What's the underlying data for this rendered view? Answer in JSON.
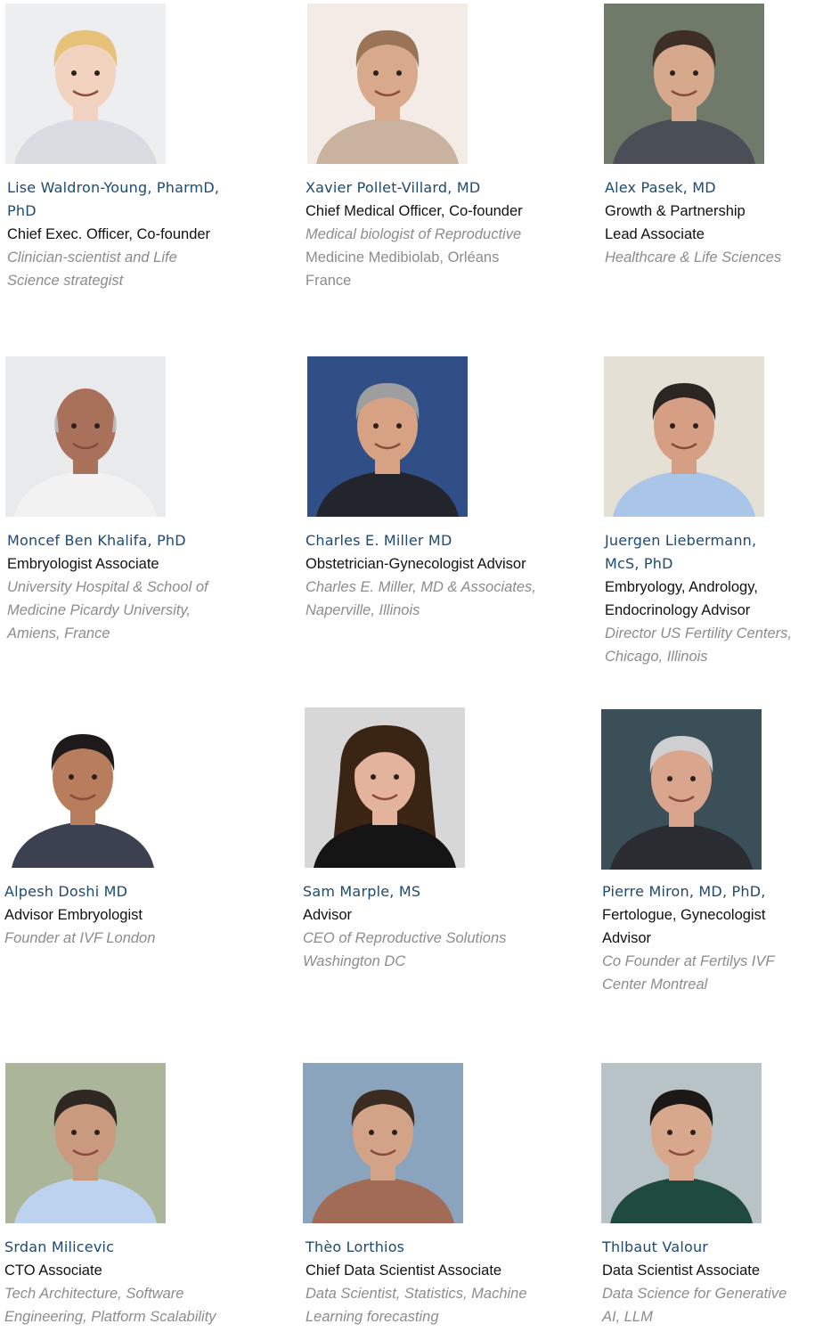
{
  "team": [
    {
      "name": [
        "Lise Waldron-Young, PharmD,",
        "PhD"
      ],
      "role": [
        "Chief Exec. Officer, Co-founder"
      ],
      "desc": [
        "Clinician-scientist and Life",
        "Science strategist"
      ],
      "desc_italic": true,
      "photo": {
        "bg": "#eceef0",
        "skin": "#f1d3c0",
        "hair": "#e6c27a",
        "cloth": "#d9dde2",
        "hair_style": "short"
      }
    },
    {
      "name": [
        "Xavier Pollet-Villard, MD"
      ],
      "role": [
        "Chief Medical Officer, Co-founder"
      ],
      "desc": [
        "Medical biologist of Reproductive",
        "Medicine Medibiolab, Orléans",
        "France"
      ],
      "desc_italic": "mixed",
      "photo": {
        "bg": "#f3ece6",
        "skin": "#d9a98c",
        "hair": "#9a7456",
        "cloth": "#c9b39f",
        "hair_style": "short"
      }
    },
    {
      "name": [
        "Alex Pasek, MD"
      ],
      "role": [
        "Growth & Partnership",
        "Lead Associate"
      ],
      "desc": [
        "Healthcare & Life Sciences"
      ],
      "desc_italic": true,
      "photo": {
        "bg": "#6f7a6a",
        "skin": "#d6a88c",
        "hair": "#3d2f25",
        "cloth": "#4a4f57",
        "hair_style": "short"
      }
    },
    {
      "name": [
        "Moncef Ben Khalifa, PhD"
      ],
      "role": [
        "Embryologist Associate"
      ],
      "desc": [
        "University Hospital & School of",
        "Medicine Picardy University,",
        "Amiens, France"
      ],
      "desc_italic": true,
      "photo": {
        "bg": "#e9eaec",
        "skin": "#a9705a",
        "hair": "#b8b8b8",
        "cloth": "#f2f2f2",
        "hair_style": "bald"
      }
    },
    {
      "name": [
        "Charles E. Miller MD"
      ],
      "role": [
        "Obstetrician-Gynecologist Advisor"
      ],
      "desc": [
        "Charles E. Miller, MD & Associates,",
        "Naperville, Illinois"
      ],
      "desc_italic": true,
      "photo": {
        "bg": "#2f4f86",
        "skin": "#d7a184",
        "hair": "#9e9e9e",
        "cloth": "#22252b",
        "hair_style": "short"
      }
    },
    {
      "name": [
        "Juergen Liebermann,",
        "McS, PhD"
      ],
      "role": [
        "Embryology, Andrology,",
        "Endocrinology Advisor"
      ],
      "desc": [
        "Director US Fertility Centers,",
        "Chicago, Illinois"
      ],
      "desc_italic": true,
      "photo": {
        "bg": "#e5e0d6",
        "skin": "#d69f83",
        "hair": "#2b2622",
        "cloth": "#a9c6e8",
        "hair_style": "short"
      }
    },
    {
      "name": [
        "Alpesh Doshi MD"
      ],
      "role": [
        "Advisor Embryologist"
      ],
      "desc": [
        "Founder at IVF London"
      ],
      "desc_italic": true,
      "photo": {
        "bg": "#ffffff",
        "skin": "#b77d5c",
        "hair": "#1d1a19",
        "cloth": "#3b4150",
        "hair_style": "short"
      }
    },
    {
      "name": [
        "Sam Marple, MS"
      ],
      "role": [
        "Advisor"
      ],
      "desc": [
        "CEO of Reproductive Solutions",
        "Washington DC"
      ],
      "desc_italic": true,
      "photo": {
        "bg": "#d7d7d7",
        "skin": "#e3b39b",
        "hair": "#3a2414",
        "cloth": "#151515",
        "hair_style": "long"
      }
    },
    {
      "name": [
        "Pierre Miron, MD, PhD,"
      ],
      "role": [
        "Fertologue, Gynecologist",
        "Advisor"
      ],
      "desc": [
        "Co Founder at Fertilys IVF",
        "Center Montreal"
      ],
      "desc_italic": true,
      "photo": {
        "bg": "#3b4f58",
        "skin": "#d9a58d",
        "hair": "#cfcfcf",
        "cloth": "#2a2c31",
        "hair_style": "curly"
      }
    },
    {
      "name": [
        "Srdan Milicevic"
      ],
      "role": [
        "CTO Associate"
      ],
      "desc": [
        "Tech Architecture, Software",
        "Engineering, Platform Scalability"
      ],
      "desc_italic": true,
      "photo": {
        "bg": "#aab59a",
        "skin": "#c99a7e",
        "hair": "#2e2722",
        "cloth": "#bcd2ee",
        "hair_style": "short"
      }
    },
    {
      "name": [
        "Thèo Lorthios"
      ],
      "role": [
        "Chief Data Scientist Associate"
      ],
      "desc": [
        "Data Scientist, Statistics, Machine",
        "Learning forecasting"
      ],
      "desc_italic": true,
      "photo": {
        "bg": "#8aa4bd",
        "skin": "#d2a386",
        "hair": "#3b2b20",
        "cloth": "#a16b55",
        "hair_style": "short"
      }
    },
    {
      "name": [
        "Thlbaut Valour"
      ],
      "role": [
        "Data Scientist Associate"
      ],
      "desc": [
        "Data Science for Generative",
        "AI, LLM"
      ],
      "desc_italic": true,
      "photo": {
        "bg": "#b7c3c6",
        "skin": "#d8a88c",
        "hair": "#1c1815",
        "cloth": "#1f4a3f",
        "hair_style": "curly"
      }
    }
  ]
}
